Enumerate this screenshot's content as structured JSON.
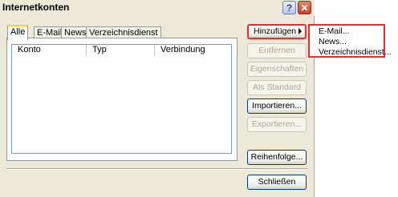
{
  "window": {
    "title": "Internetkonten",
    "help_label": "?",
    "close_label": "✕"
  },
  "tabs": [
    "Alle",
    "E-Mail",
    "News",
    "Verzeichnisdienst"
  ],
  "list": {
    "columns": [
      "Konto",
      "Typ",
      "Verbindung"
    ]
  },
  "buttons": {
    "add": "Hinzufügen",
    "remove": "Entfernen",
    "properties": "Eigenschaften",
    "set_default": "Als Standard",
    "import": "Importieren...",
    "export": "Exportieren...",
    "order": "Reihenfolge...",
    "close": "Schließen"
  },
  "add_menu": [
    "E-Mail...",
    "News...",
    "Verzeichnisdienst..."
  ]
}
